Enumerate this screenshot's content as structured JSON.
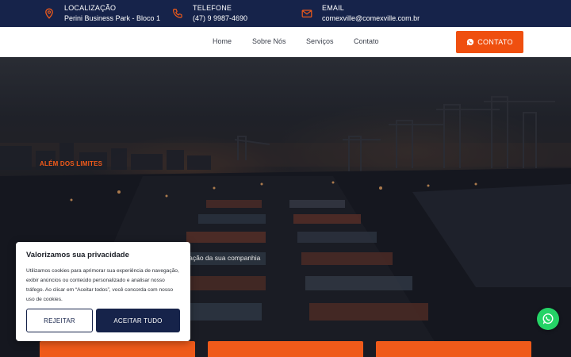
{
  "topbar": {
    "location": {
      "label": "LOCALIZAÇÃO",
      "value": "Perini Business Park - Bloco 1",
      "icon": "map-pin-icon"
    },
    "phone": {
      "label": "TELEFONE",
      "value": "(47) 9 9987-4690",
      "icon": "phone-icon"
    },
    "email": {
      "label": "EMAIL",
      "value": "comexville@comexville.com.br",
      "icon": "mail-icon"
    },
    "icon_color": "#ef5a1a",
    "background": "#16234a"
  },
  "nav": {
    "links": [
      "Home",
      "Sobre Nós",
      "Serviços",
      "Contato"
    ],
    "contact_button": "CONTATO",
    "accent": "#ef4f0f"
  },
  "hero": {
    "tagline": "ALÉM DOS LIMITES",
    "subtitle_fragment": "ização da sua companhia"
  },
  "cookie": {
    "title": "Valorizamos sua privacidade",
    "body": "Utilizamos cookies para aprimorar sua experiência de navegação, exibir anúncios ou conteúdo personalizado e analisar nosso tráfego. Ao clicar em “Aceitar todos”, você concorda com nosso uso de cookies.",
    "reject_label": "REJEITAR",
    "accept_label": "ACEITAR TUDO"
  },
  "whatsapp": {
    "icon": "whatsapp-icon",
    "color": "#25d366"
  }
}
